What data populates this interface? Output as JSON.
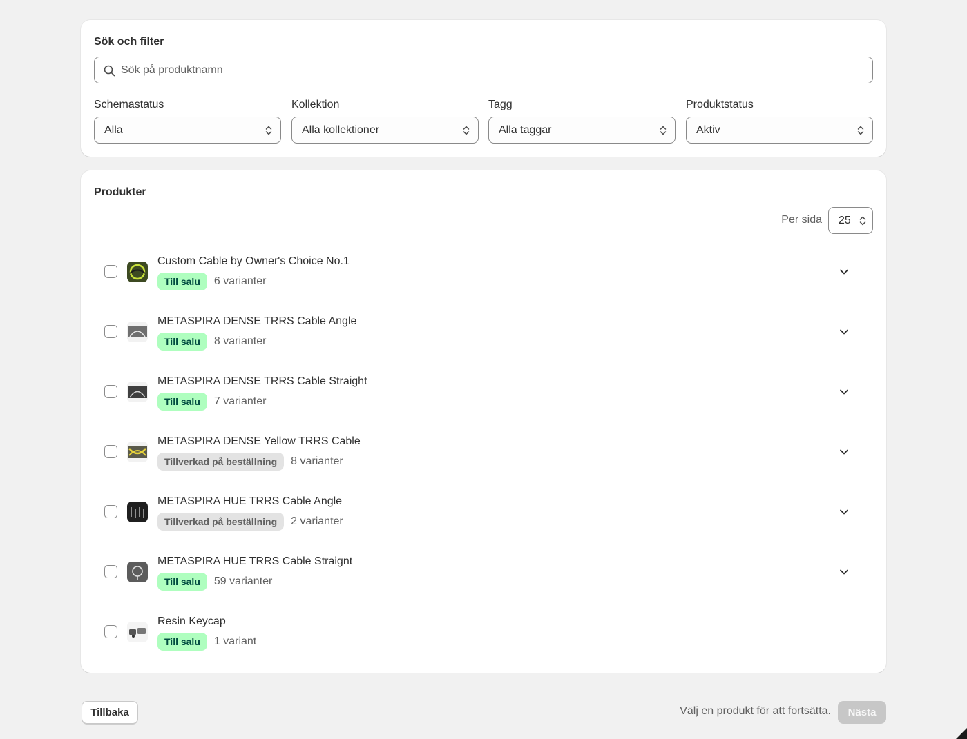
{
  "filters": {
    "title": "Sök och filter",
    "search_placeholder": "Sök på produktnamn",
    "schedule_status": {
      "label": "Schemastatus",
      "value": "Alla"
    },
    "collection": {
      "label": "Kollektion",
      "value": "Alla kollektioner"
    },
    "tag": {
      "label": "Tagg",
      "value": "Alla taggar"
    },
    "product_status": {
      "label": "Produktstatus",
      "value": "Aktiv"
    }
  },
  "products": {
    "title": "Produkter",
    "per_page_label": "Per sida",
    "per_page_value": "25",
    "items": [
      {
        "name": "Custom Cable by Owner's Choice No.1",
        "status": "Till salu",
        "variants": "6 varianter",
        "thumb_color": "#4a5a2a"
      },
      {
        "name": "METASPIRA DENSE TRRS Cable Angle",
        "status": "Till salu",
        "variants": "8 varianter",
        "thumb_color": "#7a7a7a"
      },
      {
        "name": "METASPIRA DENSE TRRS Cable Straight",
        "status": "Till salu",
        "variants": "7 varianter",
        "thumb_color": "#5a5a5a"
      },
      {
        "name": "METASPIRA DENSE Yellow TRRS Cable",
        "status": "Tillverkad på beställning",
        "variants": "8 varianter",
        "thumb_color": "#9a8a2a"
      },
      {
        "name": "METASPIRA HUE TRRS Cable Angle",
        "status": "Tillverkad på beställning",
        "variants": "2 varianter",
        "thumb_color": "#2a2a2a"
      },
      {
        "name": "METASPIRA HUE TRRS Cable Straignt",
        "status": "Till salu",
        "variants": "59 varianter",
        "thumb_color": "#6a6a6a"
      },
      {
        "name": "Resin Keycap",
        "status": "Till salu",
        "variants": "1 variant",
        "thumb_color": "#d8d8d8"
      }
    ]
  },
  "footer": {
    "back_label": "Tillbaka",
    "hint": "Välj en produkt för att fortsätta.",
    "next_label": "Nästa"
  },
  "colors": {
    "sale_badge_bg": "#affebf",
    "sale_badge_text": "#014b40",
    "made_badge_bg": "#e3e3e3",
    "next_disabled_bg": "#c7c7c7"
  }
}
